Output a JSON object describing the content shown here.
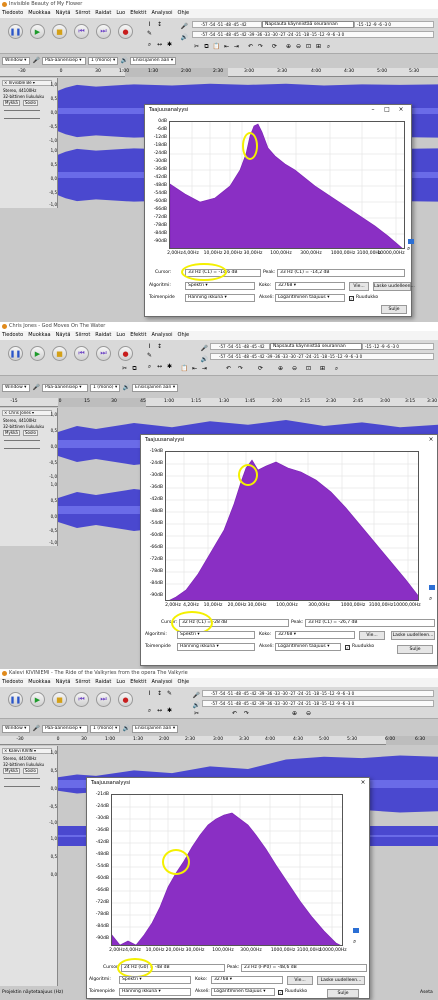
{
  "menus": [
    "Tiedosto",
    "Muokkaa",
    "Näytä",
    "Siirrot",
    "Raidat",
    "Luo",
    "Efektit",
    "Analysoi",
    "Ohje"
  ],
  "meter_hint": "Napsauta käynnistää seurannan",
  "meter_rec_ticks": "-57 -54 -51 -48 -45 -42",
  "meter_rec_tail": "-15 -12 -9 -6 -3 0",
  "meter_play_ticks": "-57 -54 -51 -48 -45 -42 -39 -36 -33 -30 -27 -24 -21 -18 -15 -12 -9 -6 -3 0",
  "host": "Window",
  "rec_device": "Pää-äänensiep",
  "channels": "1 (mono)",
  "play_device": "Ensisijainen ään",
  "spectrum_title": "Taajuusanalyysi",
  "labels": {
    "cursor": "Cursor:",
    "peak": "Peak:",
    "algorithm": "Algoritmi:",
    "function": "Toimenpide",
    "size": "Koko:",
    "axis": "Akseli:",
    "export": "Vie...",
    "replot": "Laske uudelleen...",
    "grids": "Ruudukko",
    "close": "Sulje",
    "algorithm_value": "Spektri",
    "function_value": "Hanning ikkuna",
    "size_value": "32768",
    "axis_value": "Logaritminen taajuus"
  },
  "panels": [
    {
      "title": "Invisible Beauty of My Flower",
      "track_name": "Invisible Be",
      "track_meta1": "Stereo, 44100Hz",
      "track_meta2": "32-bittinen liukuluku",
      "mute": "Mykkä",
      "solo": "Soolo",
      "ruler_ticks": [
        "-30",
        "0",
        "30",
        "1:00",
        "1:30",
        "2:00",
        "2:30",
        "3:00",
        "3:30",
        "4:00",
        "4:30",
        "5:00",
        "5:30"
      ],
      "vscale": [
        "1,0",
        "0,5",
        "0,0",
        "-0,5",
        "-1,0",
        "1,0",
        "0,5",
        "0,0",
        "-0,5",
        "-1,0"
      ],
      "db_ticks": [
        "0dB",
        "-6dB",
        "-12dB",
        "-18dB",
        "-24dB",
        "-30dB",
        "-36dB",
        "-42dB",
        "-48dB",
        "-54dB",
        "-60dB",
        "-66dB",
        "-72dB",
        "-78dB",
        "-84dB",
        "-90dB"
      ],
      "hz_ticks": [
        "2,00Hz",
        "4,00Hz",
        "10,00Hz",
        "20,00Hz",
        "30,00Hz",
        "100,00Hz",
        "300,00Hz",
        "1000,00Hz",
        "3100,00Hz",
        "10000,00Hz"
      ],
      "cursor_value": "33 Hz (C1) = -14,6 dB",
      "peak_value": "33 Hz (C1) = -14,2 dB"
    },
    {
      "title": "Chris Jones - God Moves On The Water",
      "track_name": "Chris Jones",
      "track_meta1": "Stereo, 44100Hz",
      "track_meta2": "32-bittinen liukuluku",
      "mute": "Mykkä",
      "solo": "Soolo",
      "ruler_ticks": [
        "-15",
        "0",
        "15",
        "30",
        "45",
        "1:00",
        "1:15",
        "1:30",
        "1:45",
        "2:00",
        "2:15",
        "2:30",
        "2:45",
        "3:00",
        "3:15",
        "3:30"
      ],
      "vscale": [
        "1,0",
        "0,5",
        "0,0",
        "-0,5",
        "-1,0",
        "1,0",
        "0,5",
        "0,0",
        "-0,5",
        "-1,0"
      ],
      "db_ticks": [
        "-19dB",
        "-24dB",
        "-30dB",
        "-36dB",
        "-42dB",
        "-48dB",
        "-54dB",
        "-60dB",
        "-66dB",
        "-72dB",
        "-78dB",
        "-84dB",
        "-90dB"
      ],
      "hz_ticks": [
        "2,00Hz",
        "4,20Hz",
        "10,00Hz",
        "20,00Hz",
        "30,00Hz",
        "100,00Hz",
        "300,00Hz",
        "1000,00Hz",
        "3100,00Hz",
        "10000,00Hz"
      ],
      "cursor_value": "32 Hz (C1) = -28 dB",
      "peak_value": "33 Hz (C1) = -26,7 dB"
    },
    {
      "title": "Kalevi KIVINIEMI - The Ride of the Valkyries from the opera The Valkyrie",
      "track_name": "Kalevi KIVIN",
      "track_meta1": "Stereo, 44100Hz",
      "track_meta2": "32-bittinen liukuluku",
      "mute": "Mykkä",
      "solo": "Soolo",
      "ruler_ticks": [
        "-30",
        "0",
        "30",
        "1:00",
        "1:30",
        "2:00",
        "2:30",
        "3:00",
        "3:30",
        "4:00",
        "4:30",
        "5:00",
        "5:30",
        "6:00",
        "6:30"
      ],
      "vscale": [
        "1,0",
        "0,5",
        "0,0",
        "-0,5",
        "-1,0",
        "1,0",
        "0,5",
        "0,0"
      ],
      "db_ticks": [
        "-21dB",
        "-24dB",
        "-30dB",
        "-36dB",
        "-42dB",
        "-48dB",
        "-54dB",
        "-60dB",
        "-66dB",
        "-72dB",
        "-78dB",
        "-84dB",
        "-90dB"
      ],
      "hz_ticks": [
        "2,00Hz",
        "4,00Hz",
        "10,00Hz",
        "20,00Hz",
        "30,00Hz",
        "100,00Hz",
        "300,00Hz",
        "1000,00Hz",
        "3100,00Hz",
        "10000,00Hz"
      ],
      "cursor_value": "24 Hz (G0) = -48 dB",
      "peak_value": "23 Hz (F#0) = -48,6 dB",
      "project_rate_label": "Projektin näytetaajuus (Hz)",
      "snap_label": "Aseta"
    }
  ]
}
